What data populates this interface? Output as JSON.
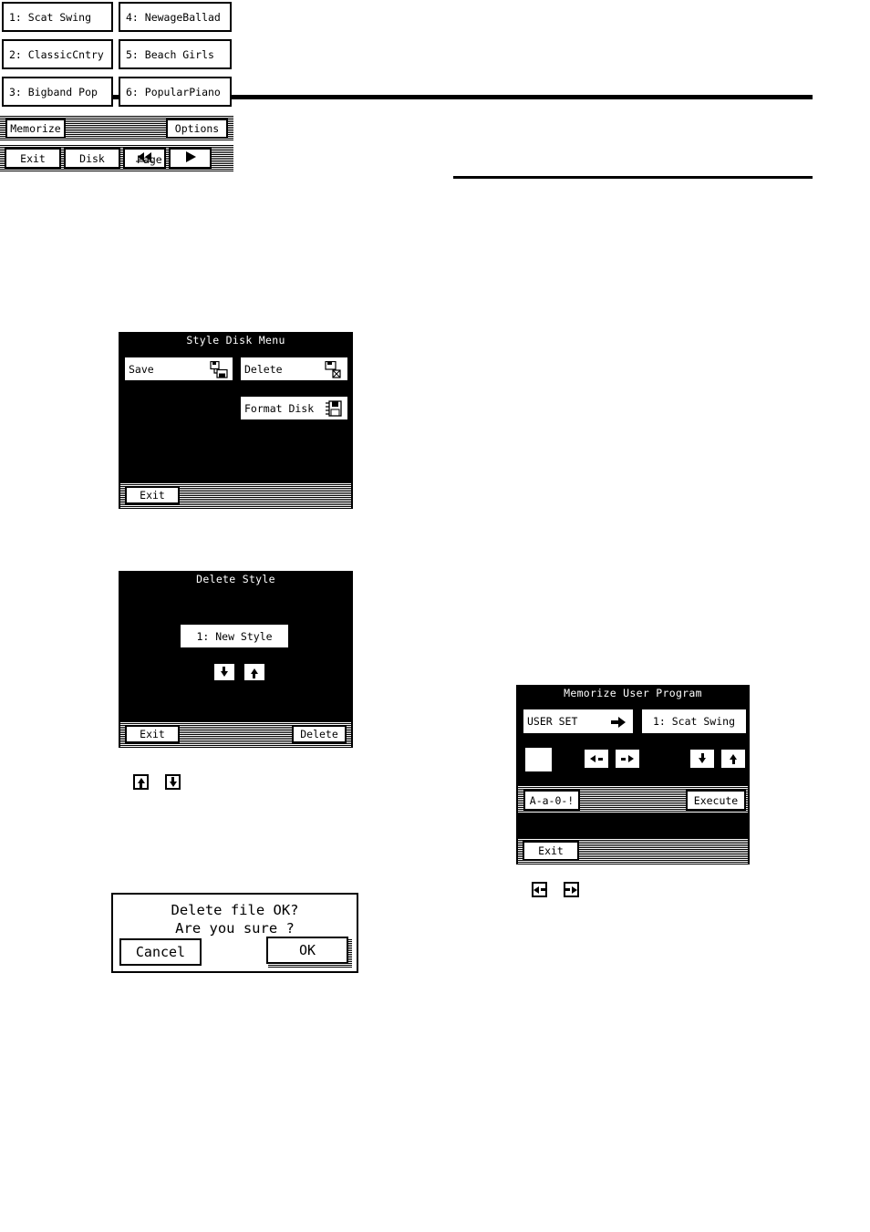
{
  "style_disk_menu": {
    "title": "Style Disk Menu",
    "buttons": [
      {
        "label": "Save",
        "icon": "disk-save-icon"
      },
      {
        "label": "Delete",
        "icon": "disk-delete-icon"
      },
      {
        "label": "Format Disk",
        "icon": "disk-format-icon"
      }
    ],
    "exit_label": "Exit"
  },
  "delete_style": {
    "title": "Delete Style",
    "item_label": "1: New Style",
    "down_icon": "arrow-down-icon",
    "up_icon": "arrow-up-icon",
    "exit_label": "Exit",
    "delete_label": "Delete"
  },
  "caption_icons_left": [
    {
      "name": "arrow-up-icon"
    },
    {
      "name": "arrow-down-icon"
    }
  ],
  "delete_dialog": {
    "line1": "Delete file OK?",
    "line2": "Are you sure ?",
    "cancel_label": "Cancel",
    "ok_label": "OK"
  },
  "user_program": {
    "slots": [
      "1: Scat Swing",
      "4: NewageBallad",
      "2: ClassicCntry",
      "5: Beach Girls",
      "3: Bigband Pop",
      "6: PopularPiano"
    ],
    "memorize_label": "Memorize",
    "options_label": "Options",
    "exit_label": "Exit",
    "disk_label": "Disk",
    "page_label": "Page",
    "prev_icon": "rewind-icon",
    "next_icon": "play-icon"
  },
  "memorize_user_program": {
    "title": "Memorize User Program",
    "name_value": "USER SET",
    "name_arrow_icon": "arrow-right-icon",
    "target_value": "1: Scat Swing",
    "cursor_label": "_",
    "left_icon": "arrow-left-icon",
    "right_icon": "arrow-right-icon",
    "down_icon": "arrow-down-icon",
    "up_icon": "arrow-up-icon",
    "charset_label": "A-a-0-!",
    "execute_label": "Execute",
    "exit_label": "Exit"
  },
  "caption_icons_right": [
    {
      "name": "arrow-left-icon"
    },
    {
      "name": "arrow-right-icon"
    }
  ]
}
